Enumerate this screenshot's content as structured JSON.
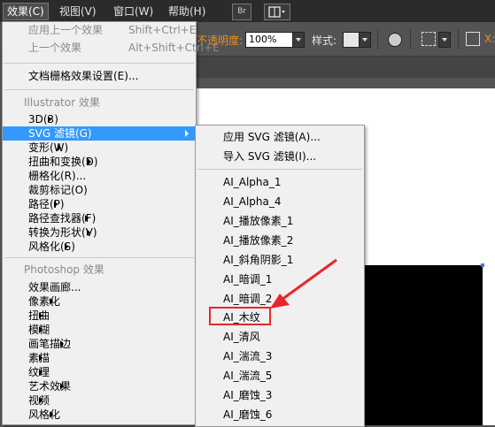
{
  "menubar": {
    "items": [
      "效果(C)",
      "视图(V)",
      "窗口(W)",
      "帮助(H)"
    ],
    "bridge_icon": "Br",
    "workspace_icon": "layout-grid-icon"
  },
  "controlbar": {
    "opacity_label": "不透明度:",
    "opacity_value": "100%",
    "style_label": "样式:",
    "x_label": "X:"
  },
  "effects_menu": {
    "items": [
      {
        "label": "应用上一个效果",
        "shortcut": "Shift+Ctrl+E",
        "disabled": true
      },
      {
        "label": "上一个效果",
        "shortcut": "Alt+Shift+Ctrl+E",
        "disabled": true
      },
      {
        "label": "文档栅格效果设置(E)..."
      },
      {
        "label": "Illustrator 效果",
        "header": true
      },
      {
        "label": "3D(3)",
        "submenu": true
      },
      {
        "label": "SVG 滤镜(G)",
        "submenu": true,
        "highlighted": true
      },
      {
        "label": "变形(W)",
        "submenu": true
      },
      {
        "label": "扭曲和变换(D)",
        "submenu": true
      },
      {
        "label": "栅格化(R)..."
      },
      {
        "label": "裁剪标记(O)"
      },
      {
        "label": "路径(P)",
        "submenu": true
      },
      {
        "label": "路径查找器(F)",
        "submenu": true
      },
      {
        "label": "转换为形状(V)",
        "submenu": true
      },
      {
        "label": "风格化(S)",
        "submenu": true
      },
      {
        "label": "Photoshop 效果",
        "header": true
      },
      {
        "label": "效果画廊..."
      },
      {
        "label": "像素化",
        "submenu": true
      },
      {
        "label": "扭曲",
        "submenu": true
      },
      {
        "label": "模糊",
        "submenu": true
      },
      {
        "label": "画笔描边",
        "submenu": true
      },
      {
        "label": "素描",
        "submenu": true
      },
      {
        "label": "纹理",
        "submenu": true
      },
      {
        "label": "艺术效果",
        "submenu": true
      },
      {
        "label": "视频",
        "submenu": true
      },
      {
        "label": "风格化",
        "submenu": true
      }
    ]
  },
  "svg_submenu": {
    "items": [
      "应用 SVG 滤镜(A)...",
      "导入 SVG 滤镜(I)...",
      "AI_Alpha_1",
      "AI_Alpha_4",
      "AI_播放像素_1",
      "AI_播放像素_2",
      "AI_斜角阴影_1",
      "AI_暗调_1",
      "AI_暗调_2",
      "AI_木纹",
      "AI_清风",
      "AI_湍流_3",
      "AI_湍流_5",
      "AI_磨蚀_3",
      "AI_磨蚀_6"
    ],
    "annotated_item": "AI_木纹",
    "annotation_color": "#e8262a"
  }
}
